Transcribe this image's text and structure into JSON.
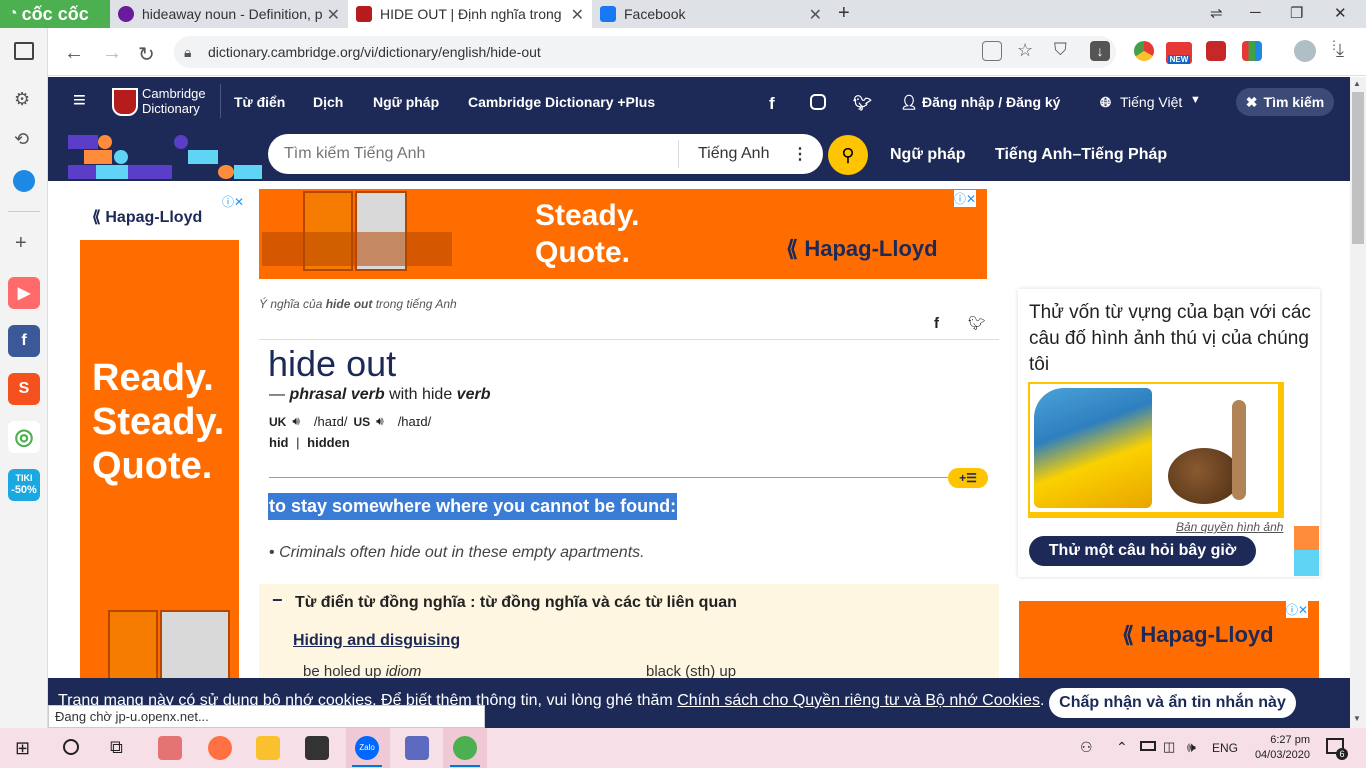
{
  "browser": {
    "brand": "cốc cốc",
    "tabs": [
      {
        "title": "hideaway noun - Definition, p"
      },
      {
        "title": "HIDE OUT | Định nghĩa trong"
      },
      {
        "title": "Facebook"
      }
    ],
    "new_tab": "+",
    "url": "dictionary.cambridge.org/vi/dictionary/english/hide-out",
    "new_badge": "NEW"
  },
  "sidebar": {
    "tiki_label": "TIKI",
    "tiki_discount": "-50%"
  },
  "header": {
    "logo_line1": "Cambridge",
    "logo_line2": "Dictionary",
    "nav": [
      "Từ điển",
      "Dịch",
      "Ngữ pháp",
      "Cambridge Dictionary +Plus"
    ],
    "login": "Đăng nhập / Đăng ký",
    "language": "Tiếng Việt",
    "search_toggle": "Tìm kiếm"
  },
  "subheader": {
    "search_placeholder": "Tìm kiếm Tiếng Anh",
    "dict_select": "Tiếng Anh",
    "link_grammar": "Ngữ pháp",
    "link_enfr": "Tiếng Anh–Tiếng Pháp"
  },
  "ads": {
    "brand": "Hapag-Lloyd",
    "top_line1": "Steady.",
    "top_line2": "Quote.",
    "left_line1": "Ready.",
    "left_line2": "Steady.",
    "left_line3": "Quote."
  },
  "entry": {
    "breadcrumb_pre": "Ý nghĩa của ",
    "breadcrumb_word": "hide out",
    "breadcrumb_post": " trong tiếng Anh",
    "headword": "hide out",
    "pos_dash": "—",
    "pos": "phrasal verb",
    "pos_with": "with hide",
    "pos_verb": "verb",
    "uk_label": "UK",
    "uk_ipa": "/haɪd/",
    "us_label": "US",
    "us_ipa": "/haɪd/",
    "forms_1": "hid",
    "forms_sep": "|",
    "forms_2": "hidden",
    "definition": "to stay somewhere where you cannot be found:",
    "example": "Criminals often hide out in these empty apartments.",
    "thesaurus_title": "Từ điển từ đồng nghĩa : từ đồng nghĩa và các từ liên quan",
    "thesaurus_topic": "Hiding and disguising",
    "thesaurus_item1": "be holed up",
    "thesaurus_item1_note": "idiom",
    "thesaurus_item2": "black (sth) up"
  },
  "quiz": {
    "title": "Thử vốn từ vựng của bạn với các câu đố hình ảnh thú vị của chúng tôi",
    "credit": "Bản quyền hình ảnh",
    "button": "Thử một câu hỏi bây giờ"
  },
  "cookie": {
    "text": "Trang mạng này có sử dụng bộ nhớ cookies. Để biết thêm thông tin, vui lòng ghé thăm ",
    "link": "Chính sách cho Quyền riêng tư và Bộ nhớ Cookies",
    "period": ".",
    "button": "Chấp nhận và ẩn tin nhắn này"
  },
  "statusbar": "Đang chờ jp-u.openx.net...",
  "taskbar": {
    "zalo": "Zalo",
    "lang": "ENG",
    "time": "6:27 pm",
    "date": "04/03/2020",
    "notif_count": "6"
  },
  "colors": {
    "cambridge_navy": "#1d2a57",
    "cambridge_yellow": "#fec400",
    "ad_orange": "#ff6d00",
    "highlight_blue": "#3a7bd5",
    "coccoc_green": "#4caf50"
  }
}
